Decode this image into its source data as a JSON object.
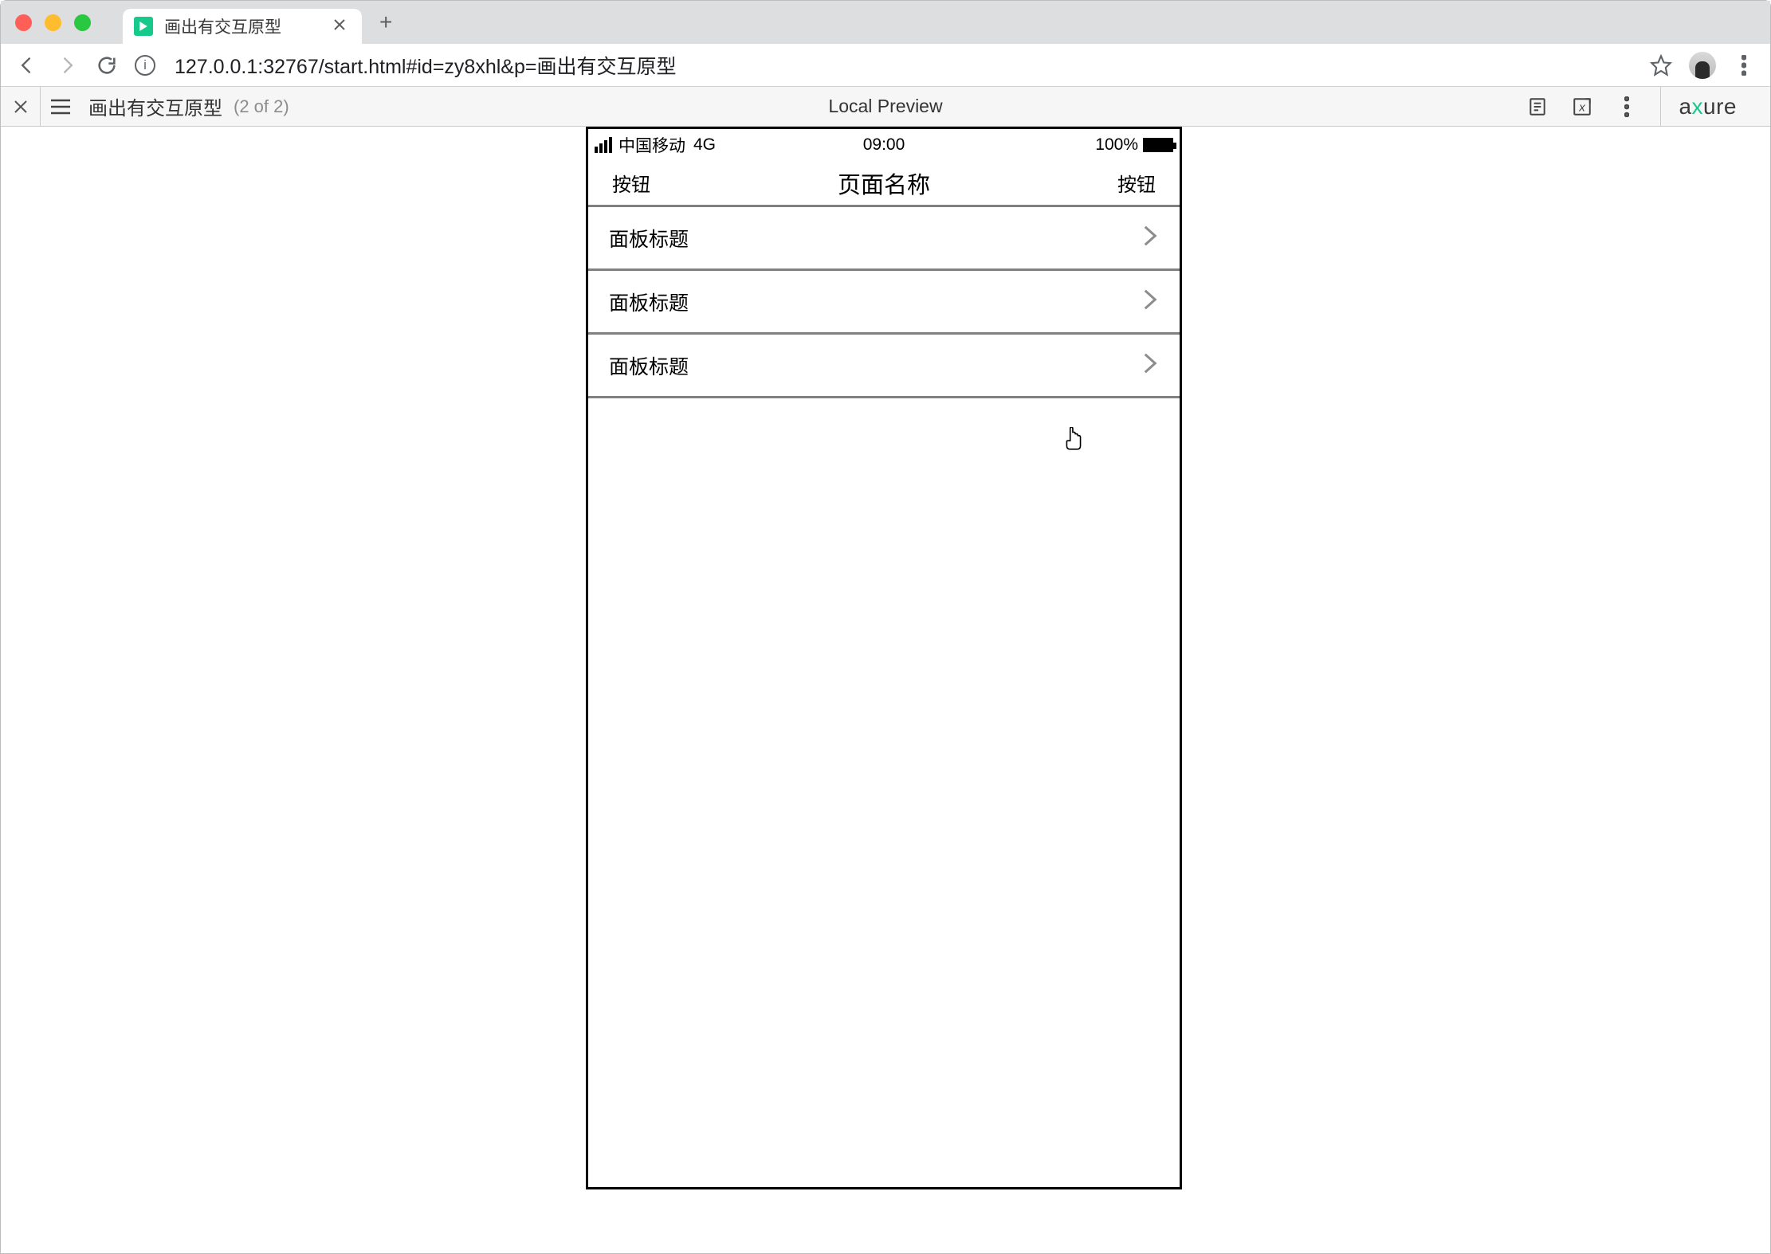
{
  "browser": {
    "tab_title": "画出有交互原型",
    "url": "127.0.0.1:32767/start.html#id=zy8xhl&p=画出有交互原型"
  },
  "preview_toolbar": {
    "page_name": "画出有交互原型",
    "page_count": "(2 of 2)",
    "center_label": "Local Preview",
    "brand_prefix": "a",
    "brand_x": "x",
    "brand_suffix": "ure"
  },
  "phone": {
    "status": {
      "carrier": "中国移动",
      "network": "4G",
      "time": "09:00",
      "battery": "100%"
    },
    "navbar": {
      "left_btn": "按钮",
      "title": "页面名称",
      "right_btn": "按钮"
    },
    "rows": [
      {
        "title": "面板标题"
      },
      {
        "title": "面板标题"
      },
      {
        "title": "面板标题"
      }
    ]
  }
}
